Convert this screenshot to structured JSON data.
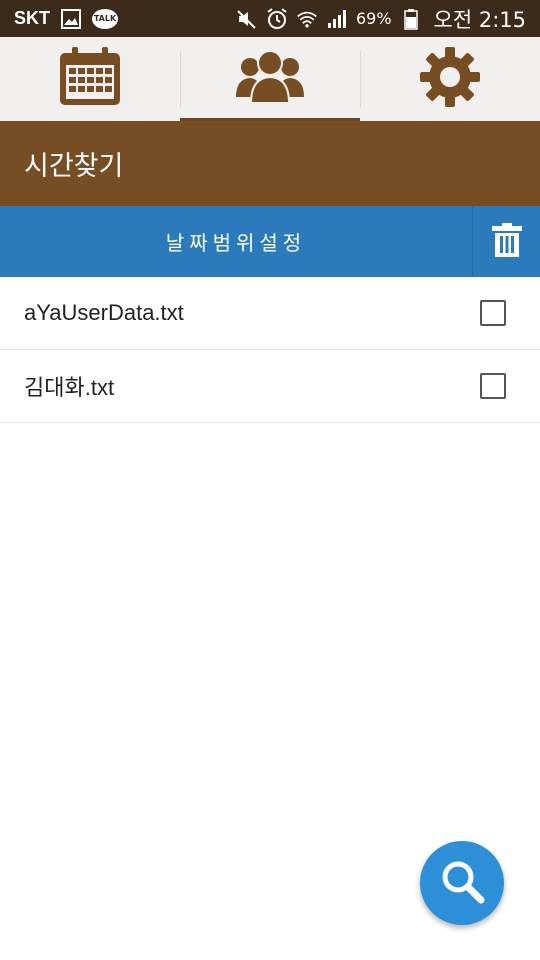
{
  "status_bar": {
    "carrier": "SKT",
    "talk_label": "TALK",
    "battery_percent": "69%",
    "time": "오전 2:15",
    "icons": [
      "gallery-icon",
      "kakaotalk-icon",
      "mute-icon",
      "alarm-icon",
      "wifi-icon",
      "signal-icon",
      "battery-icon"
    ]
  },
  "tabs": [
    {
      "icon": "calendar-icon",
      "active": false
    },
    {
      "icon": "people-icon",
      "active": true
    },
    {
      "icon": "gear-icon",
      "active": false
    }
  ],
  "title": "시간찾기",
  "action_bar": {
    "range_label": "날짜범위설정",
    "delete_icon": "trash-icon"
  },
  "files": [
    {
      "name": "aYaUserData.txt",
      "checked": false
    },
    {
      "name": "김대화.txt",
      "checked": false
    }
  ],
  "fab": {
    "icon": "search-icon"
  },
  "colors": {
    "status_bar": "#3c2b1a",
    "tab_bar": "#f1f0ee",
    "brown_icon": "#774d24",
    "title_bar": "#774d24",
    "action_bar": "#2b7abb",
    "fab": "#2e8fd9"
  }
}
